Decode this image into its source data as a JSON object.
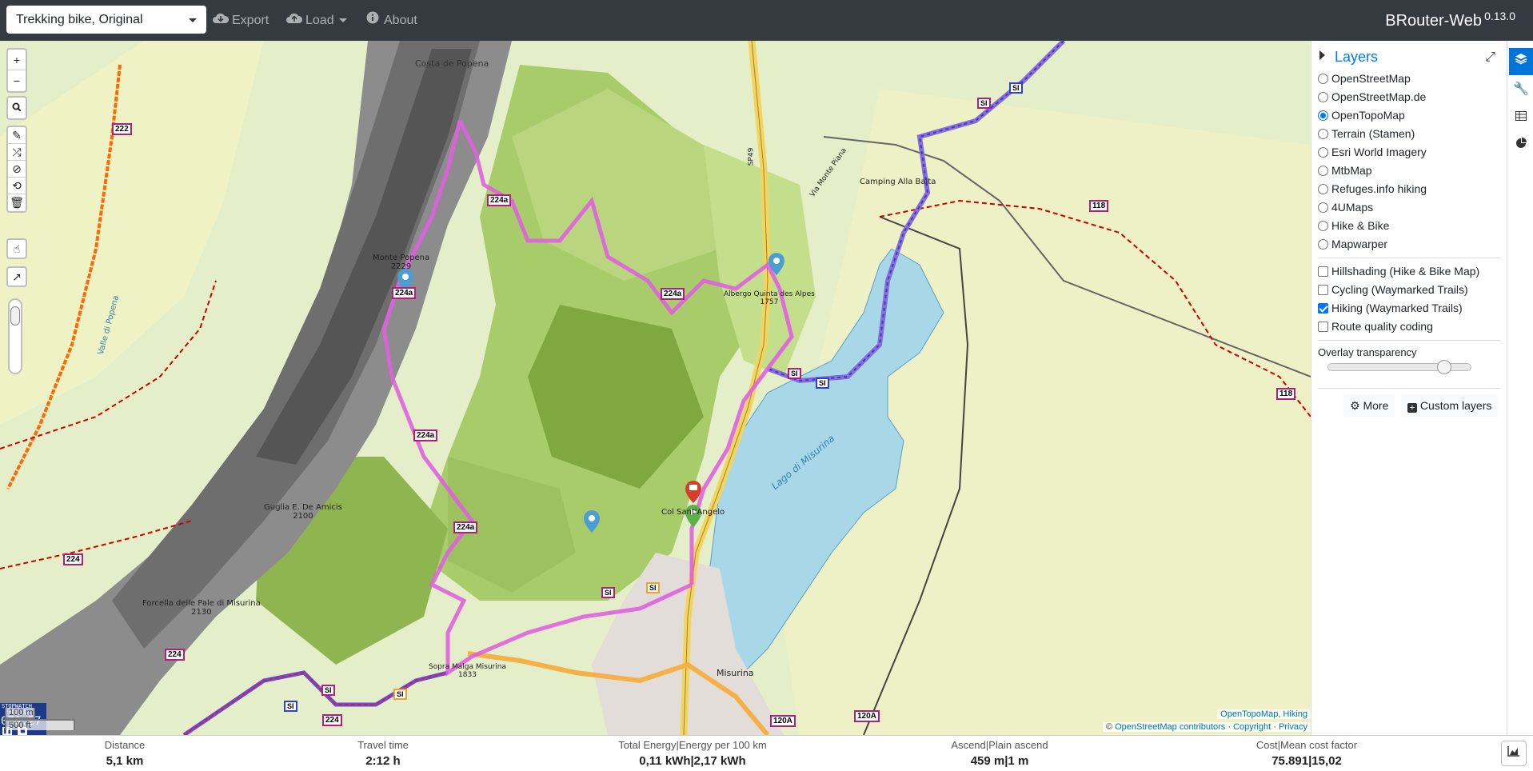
{
  "navbar": {
    "profile": "Trekking bike, Original",
    "export_label": "Export",
    "load_label": "Load",
    "about_label": "About",
    "brand": "BRouter-Web",
    "version": "0.13.0"
  },
  "map_controls": {
    "zoom_in": "+",
    "zoom_out": "−"
  },
  "map_labels": {
    "costa_popena": "Costa de Popena",
    "monte_popena": "Monte Popena",
    "monte_popena_alt": "2229",
    "guglia": "Guglia E. De Amicis",
    "guglia_alt": "2100",
    "forcella": "Forcella delle Pale di Misurina",
    "forcella_alt": "2130",
    "sopra_malga": "Sopra Malga Misurina",
    "sopra_malga_alt": "1833",
    "col_santangelo": "Col Sant'Angelo",
    "albergo": "Albergo Quinta des Alpes",
    "albergo_alt": "1757",
    "camping": "Camping Alla Baita",
    "lago": "Lago di Misurina",
    "misurina": "Misurina",
    "via_monte_piana": "Via Monte Piana",
    "sp49": "SP49",
    "valle_popena": "Valle di Popena"
  },
  "trail_tags": {
    "t222": "222",
    "t224": "224",
    "t224a": "224a",
    "t118": "118",
    "t120a": "120A",
    "tsi": "SI"
  },
  "stopwatch": {
    "title": "STOPWATCH",
    "units": "MIN  SEC",
    "time": "070:27"
  },
  "scale": {
    "metric": "100 m",
    "imperial": "500 ft"
  },
  "attribution": {
    "line1": "OpenTopoMap, Hiking",
    "line2_prefix": "©",
    "line2_osm": "OpenStreetMap contributors",
    "line2_copyright": "Copyright",
    "line2_privacy": "Privacy"
  },
  "layers_panel": {
    "title": "Layers",
    "base_layers": [
      {
        "label": "OpenStreetMap",
        "selected": false
      },
      {
        "label": "OpenStreetMap.de",
        "selected": false
      },
      {
        "label": "OpenTopoMap",
        "selected": true
      },
      {
        "label": "Terrain (Stamen)",
        "selected": false
      },
      {
        "label": "Esri World Imagery",
        "selected": false
      },
      {
        "label": "MtbMap",
        "selected": false
      },
      {
        "label": "Refuges.info hiking",
        "selected": false
      },
      {
        "label": "4UMaps",
        "selected": false
      },
      {
        "label": "Hike & Bike",
        "selected": false
      },
      {
        "label": "Mapwarper",
        "selected": false
      }
    ],
    "overlays": [
      {
        "label": "Hillshading (Hike & Bike Map)",
        "checked": false
      },
      {
        "label": "Cycling (Waymarked Trails)",
        "checked": false
      },
      {
        "label": "Hiking (Waymarked Trails)",
        "checked": true
      },
      {
        "label": "Route quality coding",
        "checked": false
      }
    ],
    "overlay_transparency_label": "Overlay transparency",
    "more_label": "More",
    "custom_layers_label": "Custom layers"
  },
  "stats": {
    "distance": {
      "label": "Distance",
      "value": "5,1 km"
    },
    "travel_time": {
      "label": "Travel time",
      "value": "2:12 h"
    },
    "energy": {
      "label": "Total Energy|Energy per 100 km",
      "value": "0,11 kWh|2,17 kWh"
    },
    "ascend": {
      "label": "Ascend|Plain ascend",
      "value": "459 m|1 m"
    },
    "cost": {
      "label": "Cost|Mean cost factor",
      "value": "75.891|15,02"
    }
  },
  "colors": {
    "navbar": "#343a40",
    "route": "#e060e0",
    "lake": "#a8d8e8",
    "accent": "#007bff",
    "active_tab": "#0074d9"
  }
}
